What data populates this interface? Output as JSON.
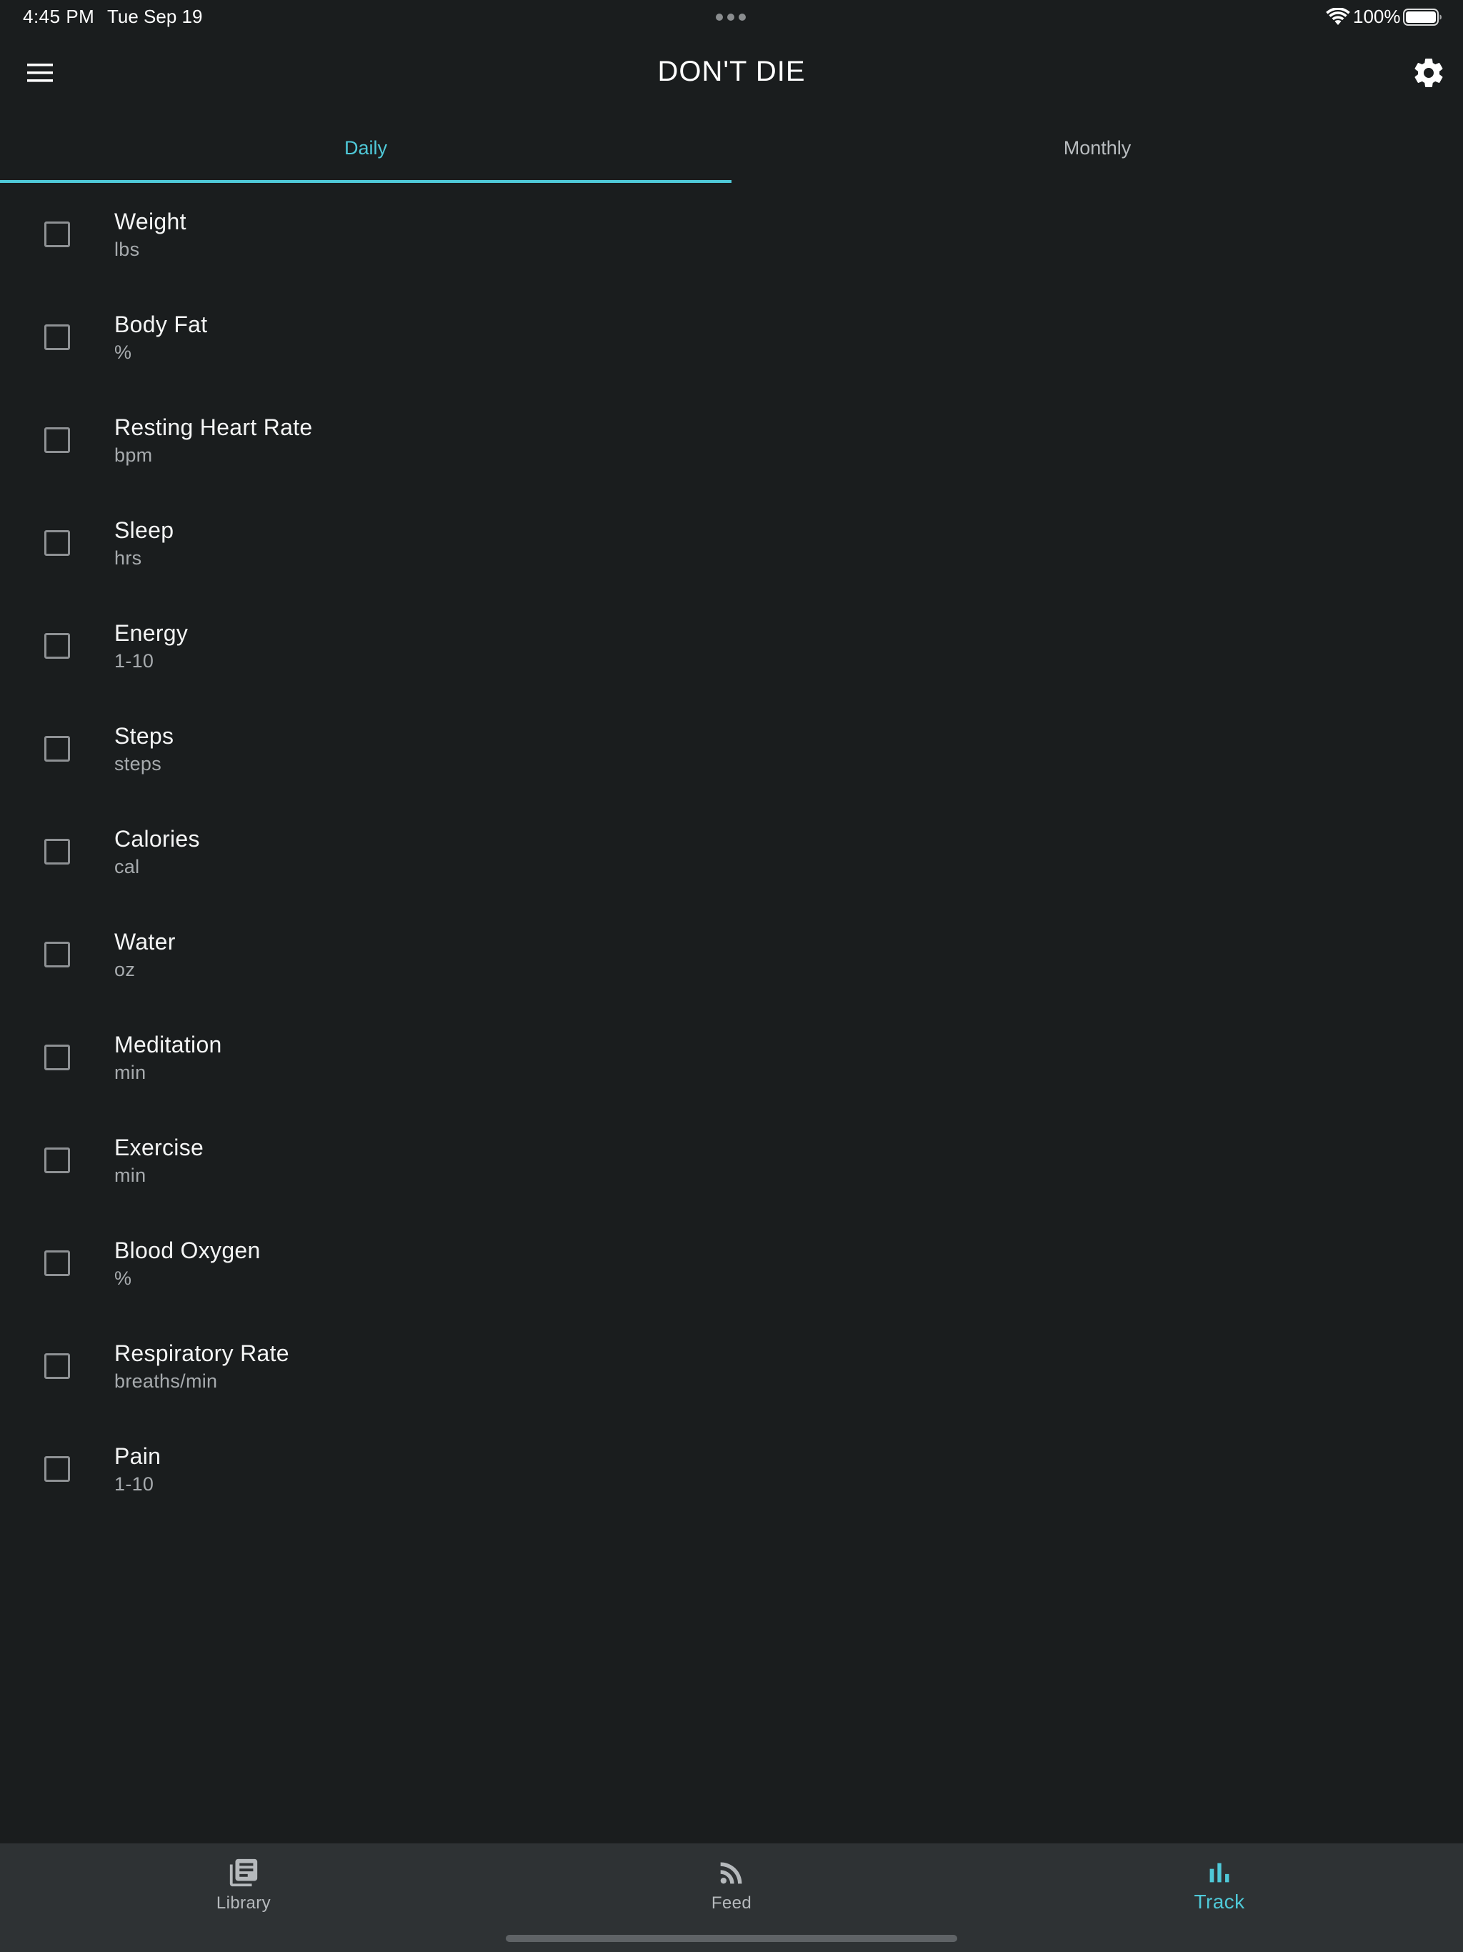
{
  "status_bar": {
    "time": "4:45 PM",
    "date": "Tue Sep 19",
    "battery": "100%",
    "icons": [
      "wifi-icon",
      "battery-icon"
    ]
  },
  "app_bar": {
    "title": "DON'T DIE",
    "left_icon": "menu-icon",
    "right_icon": "gear-icon"
  },
  "tabs": [
    {
      "label": "Daily",
      "active": true
    },
    {
      "label": "Monthly",
      "active": false
    }
  ],
  "metrics": [
    {
      "name": "Weight",
      "unit": "lbs",
      "checked": false
    },
    {
      "name": "Body Fat",
      "unit": "%",
      "checked": false
    },
    {
      "name": "Resting Heart Rate",
      "unit": "bpm",
      "checked": false
    },
    {
      "name": "Sleep",
      "unit": "hrs",
      "checked": false
    },
    {
      "name": "Energy",
      "unit": "1-10",
      "checked": false
    },
    {
      "name": "Steps",
      "unit": "steps",
      "checked": false
    },
    {
      "name": "Calories",
      "unit": "cal",
      "checked": false
    },
    {
      "name": "Water",
      "unit": "oz",
      "checked": false
    },
    {
      "name": "Meditation",
      "unit": "min",
      "checked": false
    },
    {
      "name": "Exercise",
      "unit": "min",
      "checked": false
    },
    {
      "name": "Blood Oxygen",
      "unit": "%",
      "checked": false
    },
    {
      "name": "Respiratory Rate",
      "unit": "breaths/min",
      "checked": false
    },
    {
      "name": "Pain",
      "unit": "1-10",
      "checked": false
    }
  ],
  "bottom_nav": [
    {
      "label": "Library",
      "icon": "library-icon",
      "active": false
    },
    {
      "label": "Feed",
      "icon": "rss-feed-icon",
      "active": false
    },
    {
      "label": "Track",
      "icon": "bar-chart-icon",
      "active": true
    }
  ],
  "colors": {
    "background": "#1a1d1e",
    "accent": "#4fc9d8",
    "nav_background": "#2e3234",
    "text_primary": "#f4f5f5",
    "text_secondary": "#a7abae"
  }
}
